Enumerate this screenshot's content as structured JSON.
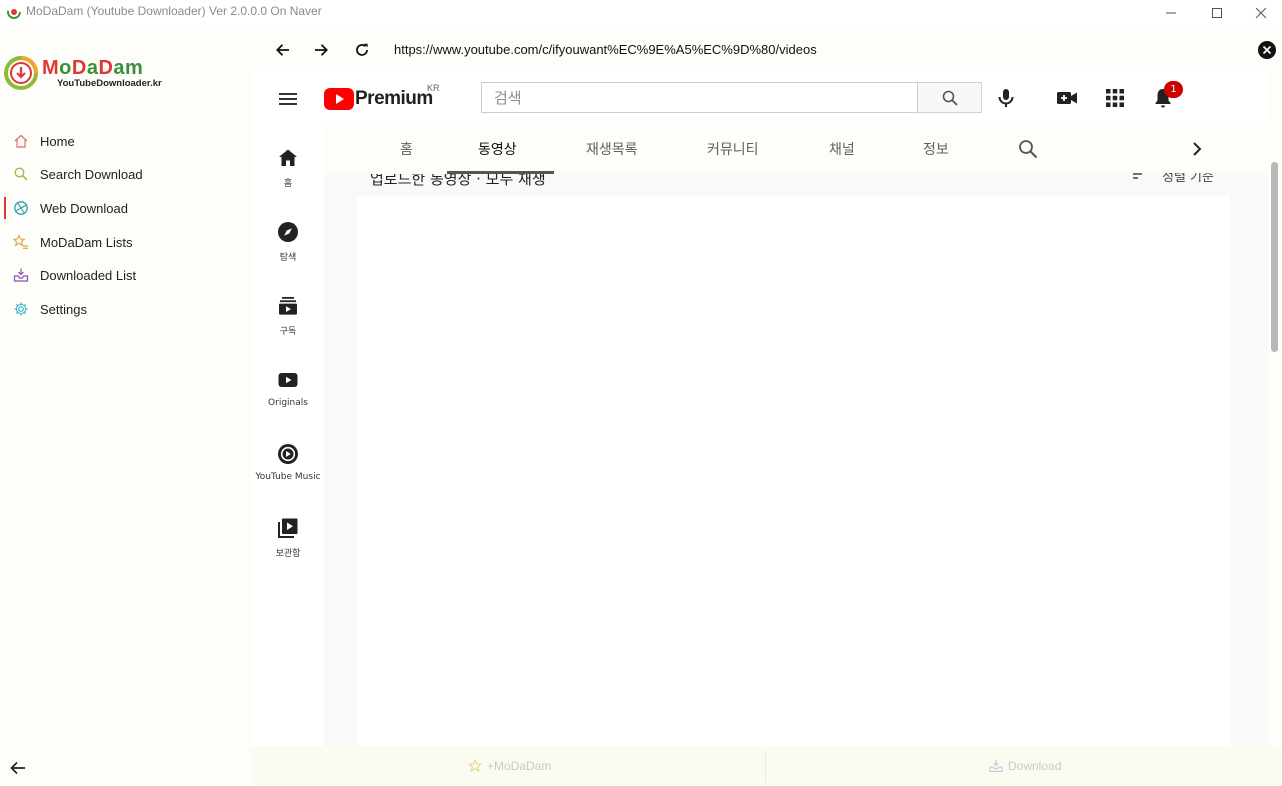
{
  "window": {
    "title": "MoDaDam (Youtube Downloader) Ver 2.0.0.0 On Naver"
  },
  "sidebar": {
    "logo_text": "MoDaDam",
    "logo_sub": "YouTubeDownloader.kr",
    "items": [
      {
        "label": "Home",
        "icon": "home-icon",
        "color": "#e06b6b"
      },
      {
        "label": "Search Download",
        "icon": "search-icon",
        "color": "#8fbf3f"
      },
      {
        "label": "Web Download",
        "icon": "globe-icon",
        "color": "#2aa0a8",
        "active": true
      },
      {
        "label": "MoDaDam Lists",
        "icon": "star-list-icon",
        "color": "#e7a23a"
      },
      {
        "label": "Downloaded List",
        "icon": "inbox-download-icon",
        "color": "#8a4fb5"
      },
      {
        "label": "Settings",
        "icon": "gear-icon",
        "color": "#3bb3c4"
      }
    ]
  },
  "browser": {
    "url": "https://www.youtube.com/c/ifyouwant%EC%9E%A5%EC%9D%80/videos"
  },
  "youtube": {
    "logo_text": "Premium",
    "region": "KR",
    "search_placeholder": "검색",
    "notification_count": "1",
    "guide": [
      {
        "label": "홈",
        "icon": "home-icon"
      },
      {
        "label": "탐색",
        "icon": "compass-icon"
      },
      {
        "label": "구독",
        "icon": "subscriptions-icon"
      },
      {
        "label": "Originals",
        "icon": "originals-icon"
      },
      {
        "label": "YouTube Music",
        "icon": "music-icon"
      },
      {
        "label": "보관함",
        "icon": "library-icon"
      }
    ],
    "tabs": [
      {
        "label": "홈"
      },
      {
        "label": "동영상",
        "active": true
      },
      {
        "label": "재생목록"
      },
      {
        "label": "커뮤니티"
      },
      {
        "label": "채널"
      },
      {
        "label": "정보"
      }
    ],
    "partial_heading": "업로드한 동영상 · 모두 재생",
    "partial_sort": "정렬 기준"
  },
  "bottom": {
    "add_label": "+MoDaDam",
    "download_label": "Download"
  }
}
